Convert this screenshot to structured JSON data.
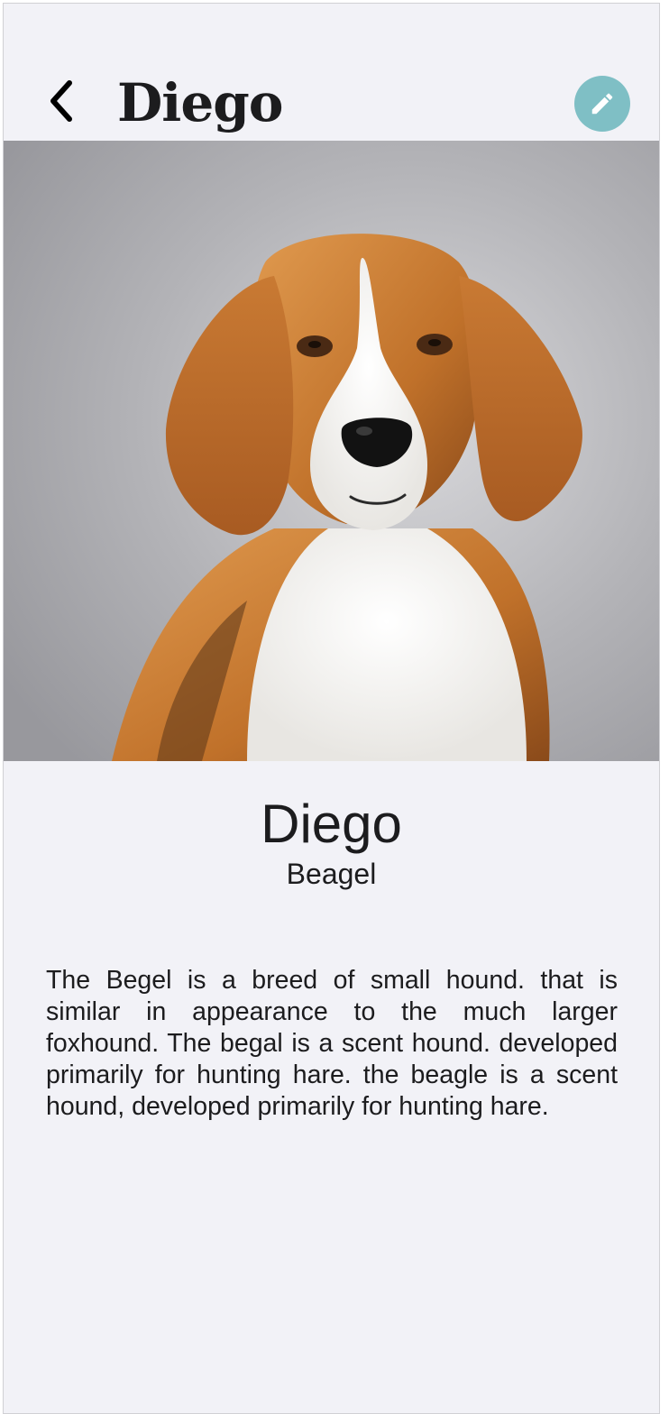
{
  "nav": {
    "title": "Diego",
    "back_icon": "chevron-left-icon",
    "edit_icon": "pencil-icon"
  },
  "colors": {
    "background": "#f2f2f7",
    "accent": "#7fbfc5",
    "text": "#1c1c1e"
  },
  "pet": {
    "photo_subject": "beagle-photo",
    "name": "Diego",
    "breed": "Beagel",
    "description": "The Begel is a breed of small hound. that is similar in appearance to the much larger foxhound. The begal is a scent hound. developed primarily for hunting hare. the beagle is a scent hound, developed primarily for hunting hare."
  }
}
